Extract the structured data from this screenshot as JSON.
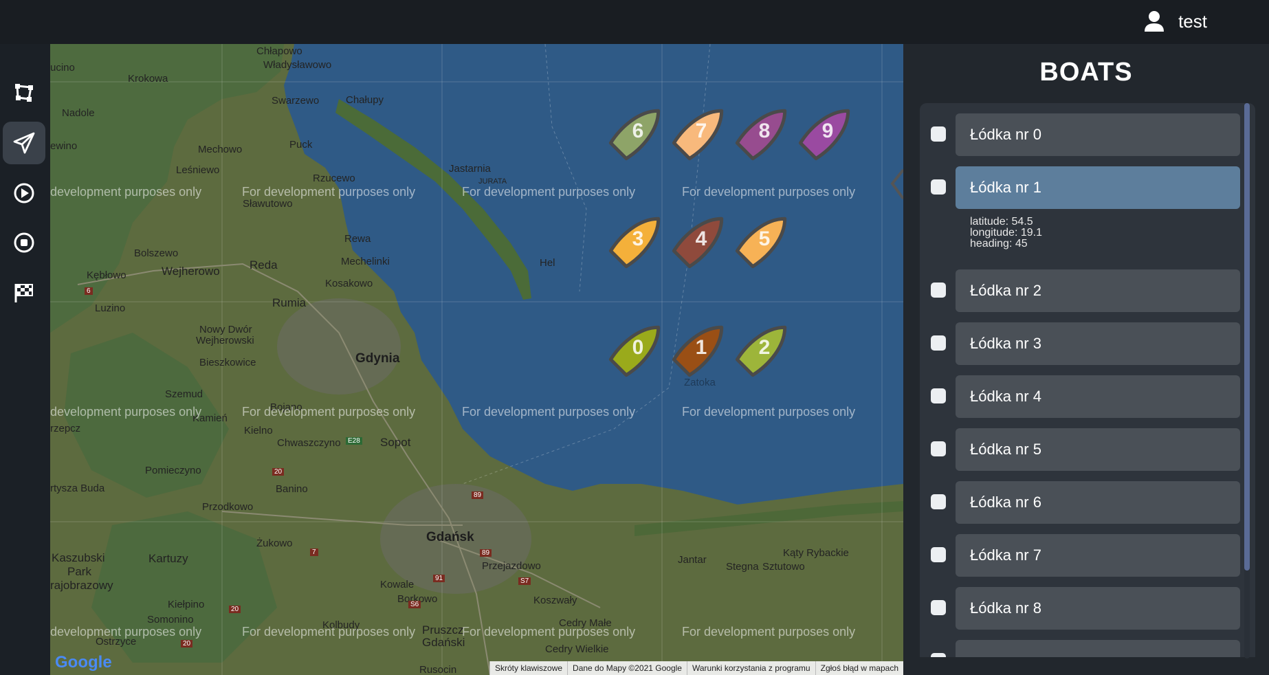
{
  "header": {
    "user_name": "test",
    "user_icon": "user-icon"
  },
  "sidebar": {
    "items": [
      {
        "name": "sidebar-polygon-button",
        "icon": "polygon-icon",
        "active": false
      },
      {
        "name": "sidebar-send-button",
        "icon": "paper-plane-icon",
        "active": true
      },
      {
        "name": "sidebar-play-button",
        "icon": "play-circle-icon",
        "active": false
      },
      {
        "name": "sidebar-stop-button",
        "icon": "stop-circle-icon",
        "active": false
      },
      {
        "name": "sidebar-finish-button",
        "icon": "checkered-flag-icon",
        "active": false
      }
    ]
  },
  "map": {
    "watermark": "For development purposes only",
    "watermark_cut": "development purposes only",
    "places": {
      "chlapowo": "Chłapowo",
      "wladyslawowo": "Władysławowo",
      "krokowa": "Krokowa",
      "nadole": "Nadole",
      "swarzewo": "Swarzewo",
      "chalupy": "Chałupy",
      "mechowo": "Mechowo",
      "puck": "Puck",
      "jastarnia": "Jastarnia",
      "jurata": "JURATA",
      "lesniewo": "Leśniewo",
      "rzucewo": "Rzucewo",
      "slawutowo": "Sławutowo",
      "rewa": "Rewa",
      "hel": "Hel",
      "bolszewo": "Bolszewo",
      "wejherowo": "Wejherowo",
      "reda": "Reda",
      "mechelinki": "Mechelinki",
      "kebłowo": "Kębłowo",
      "kosakowo": "Kosakowo",
      "luzino": "Luzino",
      "rumia": "Rumia",
      "nowy_dwor": "Nowy Dwór",
      "wejherowski": "Wejherowski",
      "gdynia": "Gdynia",
      "bieszkowice": "Bieszkowice",
      "szemud": "Szemud",
      "kamien": "Kamień",
      "kielno": "Kielno",
      "chwaszczyno": "Chwaszczyno",
      "sopot": "Sopot",
      "pomieczyno": "Pomieczyno",
      "banino": "Banino",
      "przodkowo": "Przodkowo",
      "zukowo": "Żukowo",
      "gdansk": "Gdańsk",
      "przejazdowo": "Przejazdowo",
      "kaszubski_park": "Kaszubski",
      "park": "Park",
      "krajobrazowy": "rajobrazowy",
      "kartuzy": "Kartuzy",
      "kowale": "Kowale",
      "borkowo": "Borkowo",
      "koszwaly": "Koszwały",
      "jantar": "Jantar",
      "katy": "Kąty Rybackie",
      "stegna": "Stegna",
      "sztutowo": "Sztutowo",
      "kielpino": "Kiełpino",
      "somonino": "Somonino",
      "ostrzyce": "Ostrzyce",
      "kolbudy": "Kolbudy",
      "pruszcz": "Pruszcz",
      "gdanski": "Gdański",
      "cedry_male": "Cedry Małe",
      "cedry_wielkie": "Cedry Wielkie",
      "ruscin": "Rusocin",
      "zatoka": "Zatoka",
      "ucino": "ucino",
      "ewino": "ewino",
      "rzepcz": "rzepcz",
      "tyrsza_buda": "rtysza Buda",
      "bojano": "Bojano",
      "e28": "E28",
      "r6": "6",
      "r20a": "20",
      "r20b": "20",
      "r20c": "20",
      "r7": "7",
      "r89a": "89",
      "r89b": "89",
      "r91": "91",
      "s7": "S7",
      "s6": "S6"
    },
    "boats": [
      {
        "label": "0",
        "color": "#9aaa1b"
      },
      {
        "label": "1",
        "color": "#9a4f15"
      },
      {
        "label": "2",
        "color": "#9db53a"
      },
      {
        "label": "3",
        "color": "#f4b03a"
      },
      {
        "label": "4",
        "color": "#8f4a3c"
      },
      {
        "label": "5",
        "color": "#f7b256"
      },
      {
        "label": "6",
        "color": "#8ea468"
      },
      {
        "label": "7",
        "color": "#f8b97c"
      },
      {
        "label": "8",
        "color": "#974c8f"
      },
      {
        "label": "9",
        "color": "#9a4aa1"
      }
    ],
    "attribution": [
      "Skróty klawiszowe",
      "Dane do Mapy ©2021 Google",
      "Warunki korzystania z programu",
      "Zgłoś błąd w mapach"
    ],
    "google_logo": "Google"
  },
  "panel": {
    "title": "BOATS",
    "boats": [
      {
        "label": "Łódka nr 0",
        "selected": false
      },
      {
        "label": "Łódka nr 1",
        "selected": true,
        "details": [
          "latitude: 54.5",
          "longitude: 19.1",
          "heading: 45"
        ]
      },
      {
        "label": "Łódka nr 2",
        "selected": false
      },
      {
        "label": "Łódka nr 3",
        "selected": false
      },
      {
        "label": "Łódka nr 4",
        "selected": false
      },
      {
        "label": "Łódka nr 5",
        "selected": false
      },
      {
        "label": "Łódka nr 6",
        "selected": false
      },
      {
        "label": "Łódka nr 7",
        "selected": false
      },
      {
        "label": "Łódka nr 8",
        "selected": false
      }
    ]
  }
}
